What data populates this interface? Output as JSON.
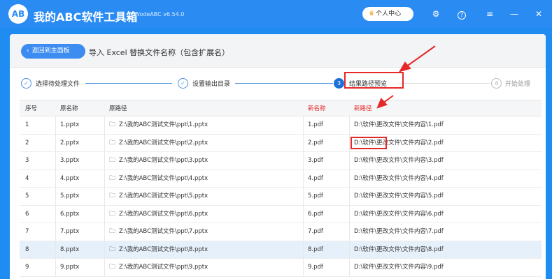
{
  "app": {
    "logo_text": "AB",
    "title": "我的ABC软件工具箱",
    "version": "WodeABC v6.54.0",
    "user_center": "个人中心"
  },
  "header": {
    "back_label": "返回到主面板",
    "page_title": "导入 Excel 替换文件名称（包含扩展名）"
  },
  "steps": [
    {
      "num": "1",
      "label": "选择待处理文件",
      "state": "done"
    },
    {
      "num": "2",
      "label": "设置输出目录",
      "state": "done"
    },
    {
      "num": "3",
      "label": "结果路径预览",
      "state": "active"
    },
    {
      "num": "4",
      "label": "开始处理",
      "state": "pending"
    }
  ],
  "table": {
    "columns": [
      "序号",
      "原名称",
      "原路径",
      "新名称",
      "新路径"
    ],
    "rows": [
      {
        "index": "1",
        "name": "1.pptx",
        "path": "Z:\\我的ABC测试文件\\ppt\\1.pptx",
        "new_name": "1.pdf",
        "new_path": "D:\\软件\\更改文件\\文件内容\\1.pdf"
      },
      {
        "index": "2",
        "name": "2.pptx",
        "path": "Z:\\我的ABC测试文件\\ppt\\2.pptx",
        "new_name": "2.pdf",
        "new_path": "D:\\软件\\更改文件\\文件内容\\2.pdf"
      },
      {
        "index": "3",
        "name": "3.pptx",
        "path": "Z:\\我的ABC测试文件\\ppt\\3.pptx",
        "new_name": "3.pdf",
        "new_path": "D:\\软件\\更改文件\\文件内容\\3.pdf"
      },
      {
        "index": "4",
        "name": "4.pptx",
        "path": "Z:\\我的ABC测试文件\\ppt\\4.pptx",
        "new_name": "4.pdf",
        "new_path": "D:\\软件\\更改文件\\文件内容\\4.pdf"
      },
      {
        "index": "5",
        "name": "5.pptx",
        "path": "Z:\\我的ABC测试文件\\ppt\\5.pptx",
        "new_name": "5.pdf",
        "new_path": "D:\\软件\\更改文件\\文件内容\\5.pdf"
      },
      {
        "index": "6",
        "name": "6.pptx",
        "path": "Z:\\我的ABC测试文件\\ppt\\6.pptx",
        "new_name": "6.pdf",
        "new_path": "D:\\软件\\更改文件\\文件内容\\6.pdf"
      },
      {
        "index": "7",
        "name": "7.pptx",
        "path": "Z:\\我的ABC测试文件\\ppt\\7.pptx",
        "new_name": "7.pdf",
        "new_path": "D:\\软件\\更改文件\\文件内容\\7.pdf"
      },
      {
        "index": "8",
        "name": "8.pptx",
        "path": "Z:\\我的ABC测试文件\\ppt\\8.pptx",
        "new_name": "8.pdf",
        "new_path": "D:\\软件\\更改文件\\文件内容\\8.pdf"
      },
      {
        "index": "9",
        "name": "9.pptx",
        "path": "Z:\\我的ABC测试文件\\ppt\\9.pptx",
        "new_name": "9.pdf",
        "new_path": "D:\\软件\\更改文件\\文件内容\\9.pdf"
      }
    ],
    "selected_row": 7
  },
  "colors": {
    "titlebar": "#2a8bf2",
    "accent": "#1e6fd9",
    "annotation": "#e62828"
  }
}
